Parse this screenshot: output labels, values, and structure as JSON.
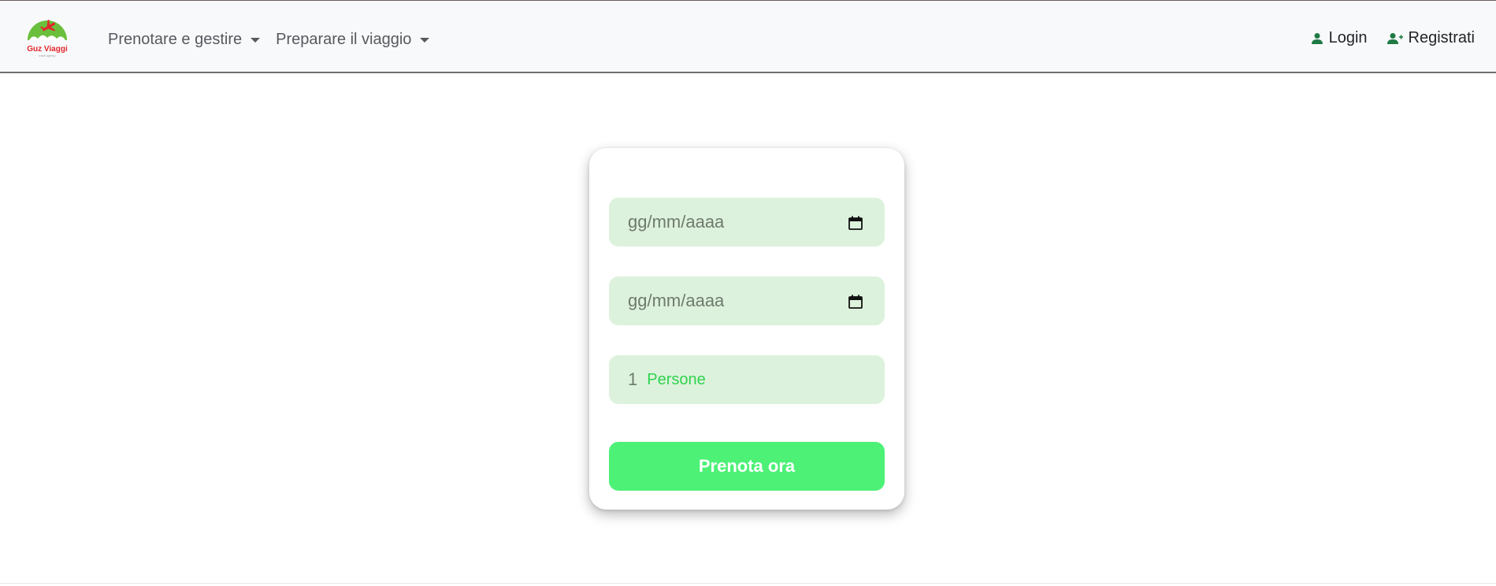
{
  "brand": {
    "logo_text": "Guz Viaggi",
    "logo_tagline": "travel agency",
    "logo_green": "#6abf3c",
    "logo_red": "#e3262b"
  },
  "nav": {
    "menus": [
      {
        "label": "Prenotare e gestire",
        "icon": "caret-down-icon"
      },
      {
        "label": "Preparare il viaggio",
        "icon": "caret-down-icon"
      }
    ],
    "login_label": "Login",
    "login_icon": "user-icon",
    "register_label": "Registrati",
    "register_icon": "user-plus-icon"
  },
  "form": {
    "date_from_placeholder": "gg/mm/aaaa",
    "date_to_placeholder": "gg/mm/aaaa",
    "date_icon": "calendar-icon",
    "persons_value": "1",
    "persons_label": "Persone",
    "submit_label": "Prenota ora"
  },
  "colors": {
    "field_bg": "#ddf2dc",
    "button_bg": "#4cf176",
    "accent_green": "#2fd34f",
    "icon_green": "#1f7a44"
  }
}
